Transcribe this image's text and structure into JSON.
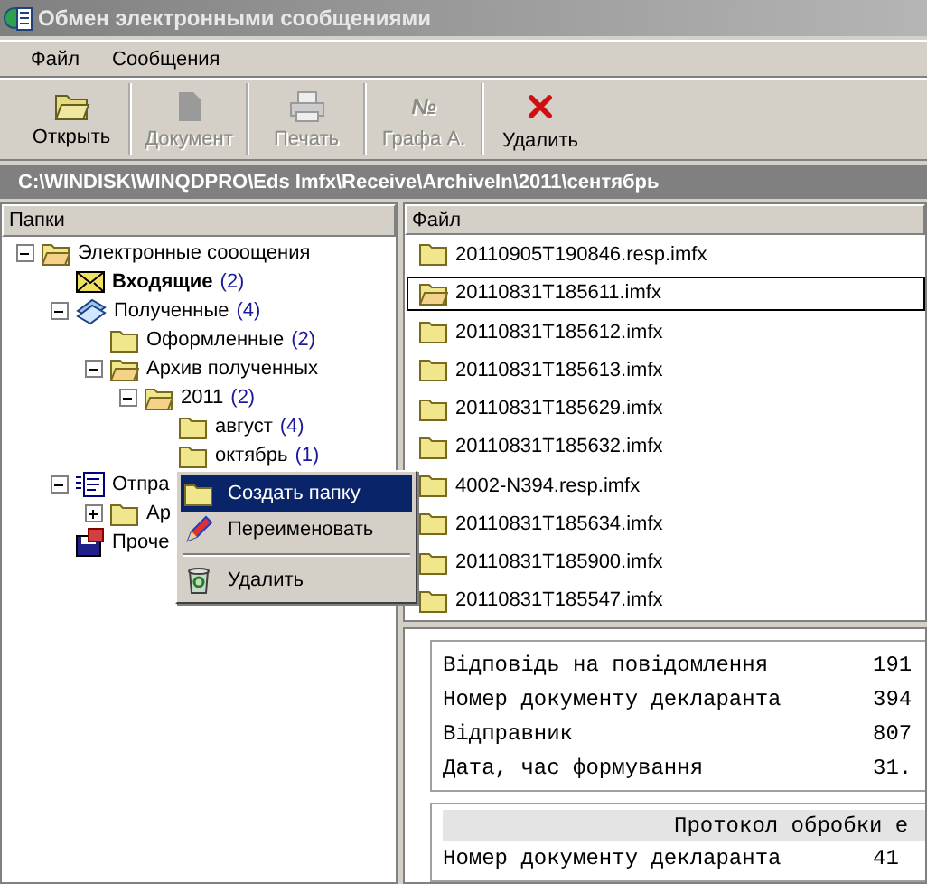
{
  "window": {
    "title": "Обмен электронными сообщениями"
  },
  "menu": [
    "Файл",
    "Сообщения"
  ],
  "toolbar": [
    {
      "label": "Открыть",
      "kind": "open",
      "disabled": false
    },
    {
      "label": "Документ",
      "kind": "document",
      "disabled": true
    },
    {
      "label": "Печать",
      "kind": "print",
      "disabled": true
    },
    {
      "label": "Графа А.",
      "kind": "number",
      "glyph": "№",
      "disabled": true
    },
    {
      "label": "Удалить",
      "kind": "delete",
      "disabled": false
    }
  ],
  "path": "C:\\WINDISK\\WINQDPRO\\Eds Imfx\\Receive\\ArchiveIn\\2011\\сентябрь",
  "folders": {
    "title": "Папки",
    "tree": [
      {
        "label": "Электронные сооощения",
        "kind": "open-folder",
        "expanded": true,
        "children": [
          {
            "label": "Входящие",
            "count": "(2)",
            "kind": "inbox",
            "bold": true
          },
          {
            "label": "Полученные",
            "count": "(4)",
            "kind": "received",
            "expanded": true,
            "children": [
              {
                "label": "Оформленные",
                "count": "(2)",
                "kind": "folder"
              },
              {
                "label": "Архив полученных",
                "kind": "open-folder",
                "expanded": true,
                "children": [
                  {
                    "label": "2011",
                    "count": "(2)",
                    "kind": "open-folder",
                    "expanded": true,
                    "children": [
                      {
                        "label": "август",
                        "count": "(4)",
                        "kind": "folder"
                      },
                      {
                        "label": "октябрь",
                        "count": "(1)",
                        "kind": "folder"
                      }
                    ]
                  }
                ]
              }
            ]
          },
          {
            "label": "Отпра",
            "kind": "outbox",
            "expanded": true,
            "children": [
              {
                "label": "Ар",
                "kind": "folder",
                "expanded": false
              }
            ]
          },
          {
            "label": "Проче",
            "kind": "other"
          }
        ]
      }
    ]
  },
  "context_menu": [
    {
      "label": "Создать папку",
      "kind": "folder",
      "selected": true
    },
    {
      "label": "Переименовать",
      "kind": "rename",
      "selected": false
    },
    {
      "label": "Удалить",
      "kind": "recycle",
      "selected": false,
      "separator_before": true
    }
  ],
  "files": {
    "column": "Файл",
    "rows": [
      {
        "name": "20110905T190846.resp.imfx",
        "focused": false
      },
      {
        "name": "20110831T185611.imfx",
        "focused": true
      },
      {
        "name": "20110831T185612.imfx",
        "focused": false
      },
      {
        "name": "20110831T185613.imfx",
        "focused": false
      },
      {
        "name": "20110831T185629.imfx",
        "focused": false
      },
      {
        "name": "20110831T185632.imfx",
        "focused": false
      },
      {
        "name": "4002-N394.resp.imfx",
        "focused": false
      },
      {
        "name": "20110831T185634.imfx",
        "focused": false
      },
      {
        "name": "20110831T185900.imfx",
        "focused": false
      },
      {
        "name": "20110831T185547.imfx",
        "focused": false
      }
    ]
  },
  "document": {
    "sections": [
      {
        "rows": [
          {
            "label": "Відповідь на повідомлення",
            "value": "191"
          },
          {
            "label": "Номер документу декларанта",
            "value": "394"
          },
          {
            "label": "Відправник",
            "value": "807"
          },
          {
            "label": "Дата, час формування",
            "value": "31."
          }
        ]
      },
      {
        "title": "Протокол обробки е",
        "rows": [
          {
            "label": "Номер документу декларанта",
            "value": "41"
          }
        ]
      }
    ]
  }
}
